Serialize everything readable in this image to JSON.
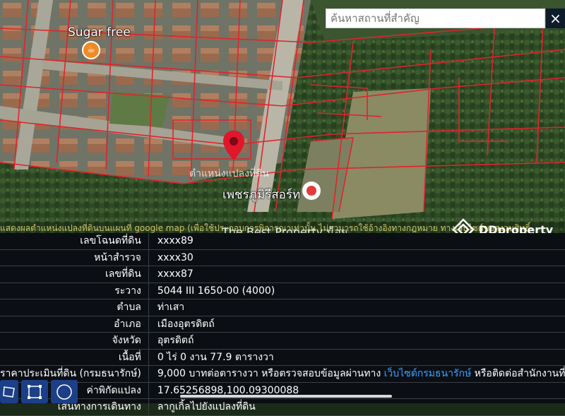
{
  "search": {
    "placeholder": "ค้นหาสถานที่สำคัญ"
  },
  "close_label": "×",
  "map": {
    "poi_cafe": "Sugar free",
    "poi_resort": "เพชรภูมิรีสอร์ท",
    "parcel_label_faded": "ตำแหน่งแปลงที่ดิน",
    "disclaimer": "แสดงผลตำแหน่งแปลงที่ดินบนแผนที่ google map (เพื่อใช้ประกอบการพิจารณาเท่านั้น ไม่สามารถใช้อ้างอิงทางกฎหมาย ทางเว็บไซต์ขอสงวนสิทธิ์",
    "watermark": "The Best Property น้อย",
    "brand": "DDproperty",
    "pin_color": "#e0162b"
  },
  "info": {
    "rows": [
      {
        "label": "เลขโฉนดที่ดิน",
        "value": "xxxx89"
      },
      {
        "label": "หน้าสำรวจ",
        "value": "xxxx30"
      },
      {
        "label": "เลขที่ดิน",
        "value": "xxxx87"
      },
      {
        "label": "ระวาง",
        "value": "5044 III 1650-00 (4000)"
      },
      {
        "label": "ตำบล",
        "value": "ท่าเสา"
      },
      {
        "label": "อำเภอ",
        "value": "เมืองอุตรดิตถ์"
      },
      {
        "label": "จังหวัด",
        "value": "อุตรดิตถ์"
      },
      {
        "label": "เนื้อที่",
        "value": "0 ไร่ 0 งาน 77.9 ตารางวา"
      }
    ],
    "price": {
      "label": "ราคาประเมินที่ดิน (กรมธนารักษ์)",
      "value_prefix": "9,000 บาทต่อตารางวา หรือตรวจสอบข้อมูลผ่านทาง ",
      "link": "เว็บไซต์กรมธนารักษ์",
      "value_suffix": " หรือติดต่อสำนักงานที่ดิน"
    },
    "coords": {
      "label": "ค่าพิกัดแปลง",
      "value": "17.65256898,100.09300088"
    },
    "route": {
      "label": "เส้นทางการเดินทาง",
      "value": "ลากูเกิ้ลไปยังแปลงที่ดิน"
    }
  },
  "tools": [
    "polygon-icon",
    "rectangle-icon",
    "circle-icon"
  ]
}
